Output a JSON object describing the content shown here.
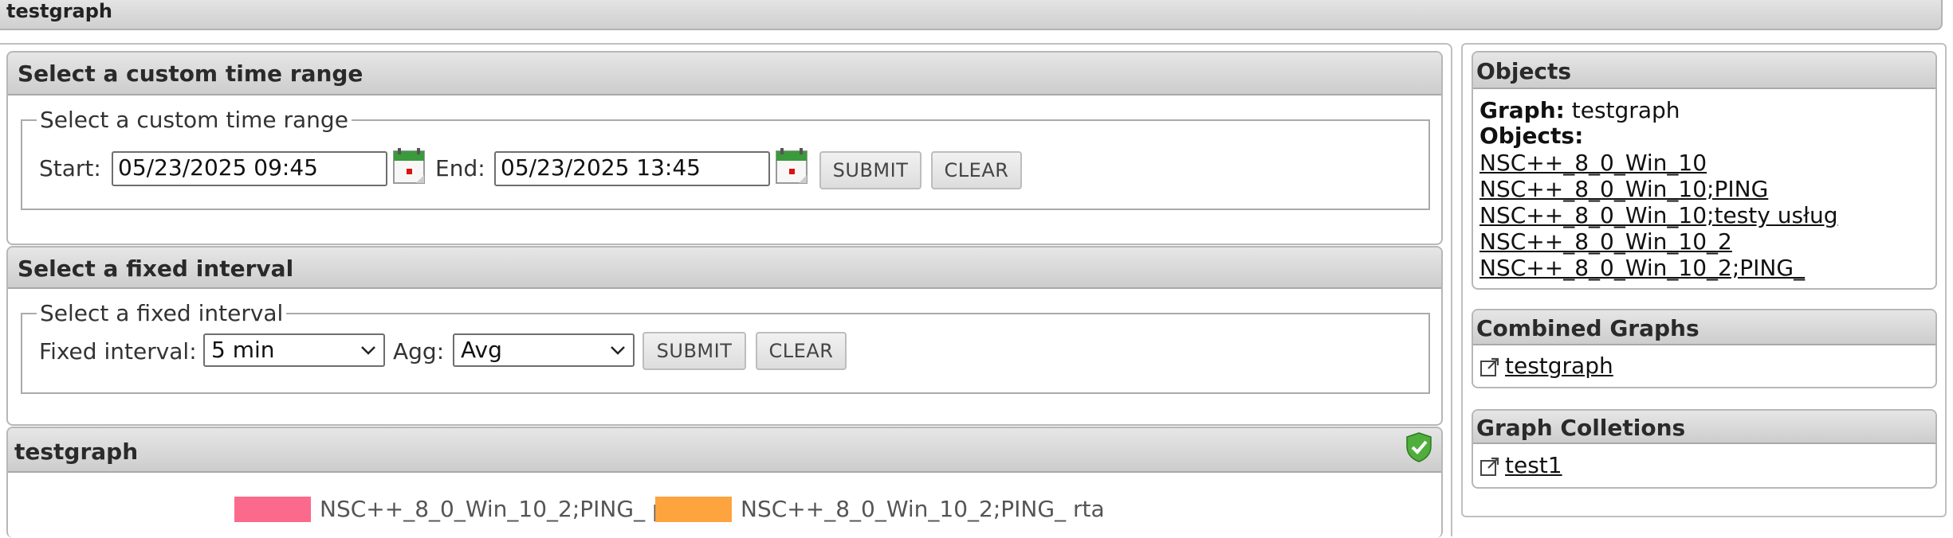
{
  "app": {
    "title": "testgraph"
  },
  "custom_range": {
    "header": "Select a custom time range",
    "legend": "Select a custom time range",
    "start_label": "Start:",
    "start_value": "05/23/2025 09:45",
    "end_label": "End:",
    "end_value": "05/23/2025 13:45",
    "submit_label": "SUBMIT",
    "clear_label": "CLEAR"
  },
  "fixed_interval": {
    "header": "Select a fixed interval",
    "legend": "Select a fixed interval",
    "interval_label": "Fixed interval:",
    "interval_value": "5 min",
    "agg_label": "Agg:",
    "agg_value": "Avg",
    "submit_label": "SUBMIT",
    "clear_label": "CLEAR"
  },
  "graph": {
    "header": "testgraph",
    "legend": [
      {
        "label": "NSC++_8_0_Win_10_2;PING_ pl",
        "color": "#fc6a8b"
      },
      {
        "label": "NSC++_8_0_Win_10_2;PING_ rta",
        "color": "#fda43f"
      }
    ]
  },
  "objects": {
    "header": "Objects",
    "graph_label": "Graph:",
    "graph_value": "testgraph",
    "objects_label": "Objects:",
    "items": [
      "NSC++_8_0_Win_10",
      "NSC++_8_0_Win_10;PING",
      "NSC++_8_0_Win_10;testy usług",
      "NSC++_8_0_Win_10_2",
      "NSC++_8_0_Win_10_2;PING_"
    ]
  },
  "combined_graphs": {
    "header": "Combined Graphs",
    "items": [
      "testgraph"
    ]
  },
  "graph_collections": {
    "header": "Graph Colletions",
    "items": [
      "test1"
    ]
  },
  "icons": {
    "calendar": "calendar-icon",
    "shield": "shield-check-icon",
    "external": "external-link-icon",
    "chevron": "chevron-down-icon"
  }
}
